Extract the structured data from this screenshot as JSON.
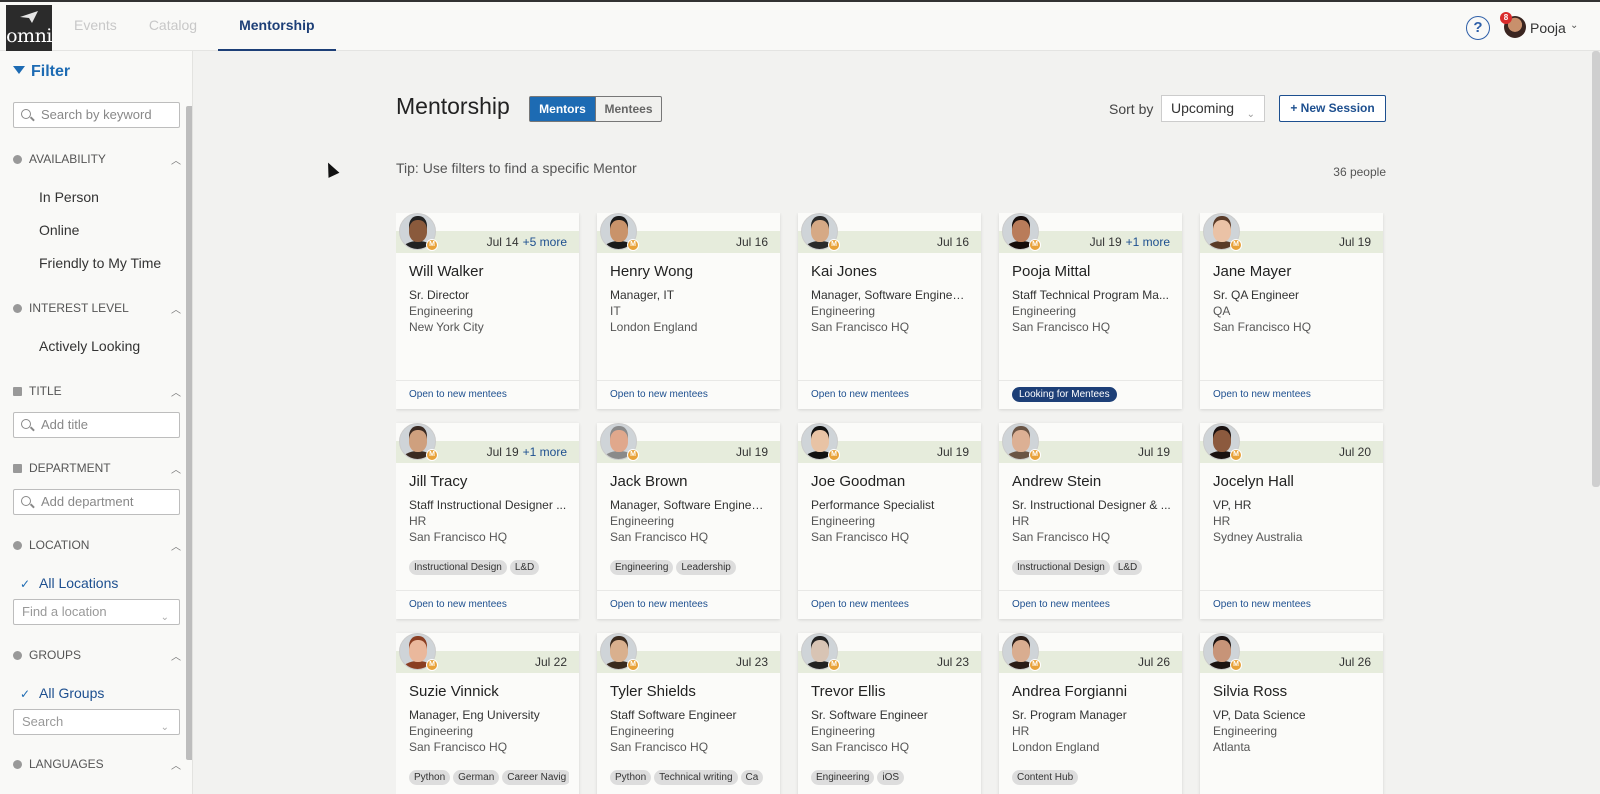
{
  "header": {
    "logo_text": "omni",
    "tabs": [
      {
        "label": "Events"
      },
      {
        "label": "Catalog"
      },
      {
        "label": "Mentorship"
      }
    ],
    "help_label": "?",
    "user": {
      "name": "Pooja",
      "notifications": "8"
    }
  },
  "sidebar": {
    "filter_label": "Filter",
    "search_placeholder": "Search by keyword",
    "availability": {
      "label": "AVAILABILITY",
      "items": [
        "In Person",
        "Online",
        "Friendly to My Time"
      ]
    },
    "interest": {
      "label": "INTEREST LEVEL",
      "items": [
        "Actively Looking"
      ]
    },
    "title": {
      "label": "TITLE",
      "placeholder": "Add title"
    },
    "department": {
      "label": "DEPARTMENT",
      "placeholder": "Add department"
    },
    "location": {
      "label": "LOCATION",
      "selected": "All Locations",
      "placeholder": "Find a location"
    },
    "groups": {
      "label": "GROUPS",
      "selected": "All Groups",
      "placeholder": "Search"
    },
    "languages": {
      "label": "LANGUAGES"
    }
  },
  "main": {
    "title": "Mentorship",
    "toggle": {
      "mentors": "Mentors",
      "mentees": "Mentees"
    },
    "sort_label": "Sort by",
    "sort_value": "Upcoming",
    "new_session": "+ New Session",
    "tip": "Tip: Use filters to find a specific Mentor",
    "count": "36 people",
    "cards": [
      {
        "name": "Will Walker",
        "date": "Jul 14",
        "more": "+5 more",
        "title": "Sr. Director",
        "dept": "Engineering",
        "loc": "New York City",
        "tags": [],
        "status": "Open to new mentees",
        "looking": false,
        "skin": "#8a5a3c",
        "hair": "#222"
      },
      {
        "name": "Henry Wong",
        "date": "Jul 16",
        "more": "",
        "title": "Manager, IT",
        "dept": "IT",
        "loc": "London England",
        "tags": [],
        "status": "Open to new mentees",
        "looking": false,
        "skin": "#c9936a",
        "hair": "#1a1a1a"
      },
      {
        "name": "Kai Jones",
        "date": "Jul 16",
        "more": "",
        "title": "Manager, Software Engineer...",
        "dept": "Engineering",
        "loc": "San Francisco HQ",
        "tags": [],
        "status": "Open to new mentees",
        "looking": false,
        "skin": "#d6a985",
        "hair": "#2a2a2a"
      },
      {
        "name": "Pooja Mittal",
        "date": "Jul 19",
        "more": "+1 more",
        "title": "Staff Technical Program Ma...",
        "dept": "Engineering",
        "loc": "San Francisco HQ",
        "tags": [],
        "status": "Looking for Mentees",
        "looking": true,
        "skin": "#b97c5a",
        "hair": "#140c0a"
      },
      {
        "name": "Jane Mayer",
        "date": "Jul 19",
        "more": "",
        "title": "Sr. QA Engineer",
        "dept": "QA",
        "loc": "San Francisco HQ",
        "tags": [],
        "status": "Open to new mentees",
        "looking": false,
        "skin": "#eac2a6",
        "hair": "#5a3b28"
      },
      {
        "name": "Jill Tracy",
        "date": "Jul 19",
        "more": "+1 more",
        "title": "Staff Instructional Designer ...",
        "dept": "HR",
        "loc": "San Francisco HQ",
        "tags": [
          "Instructional Design",
          "L&D"
        ],
        "status": "Open to new mentees",
        "looking": false,
        "skin": "#cfa07e",
        "hair": "#3a2a22"
      },
      {
        "name": "Jack Brown",
        "date": "Jul 19",
        "more": "",
        "title": "Manager, Software Engineer...",
        "dept": "Engineering",
        "loc": "San Francisco HQ",
        "tags": [
          "Engineering",
          "Leadership"
        ],
        "status": "Open to new mentees",
        "looking": false,
        "skin": "#e0a88c",
        "hair": "#8a8a8a"
      },
      {
        "name": "Joe Goodman",
        "date": "Jul 19",
        "more": "",
        "title": "Performance Specialist",
        "dept": "Engineering",
        "loc": "San Francisco HQ",
        "tags": [],
        "status": "Open to new mentees",
        "looking": false,
        "skin": "#e8c3a5",
        "hair": "#111"
      },
      {
        "name": "Andrew Stein",
        "date": "Jul 19",
        "more": "",
        "title": "Sr. Instructional Designer & ...",
        "dept": "HR",
        "loc": "San Francisco HQ",
        "tags": [
          "Instructional Design",
          "L&D"
        ],
        "status": "Open to new mentees",
        "looking": false,
        "skin": "#dcb094",
        "hair": "#6a5444"
      },
      {
        "name": "Jocelyn Hall",
        "date": "Jul 20",
        "more": "",
        "title": "VP, HR",
        "dept": "HR",
        "loc": "Sydney Australia",
        "tags": [],
        "status": "Open to new mentees",
        "looking": false,
        "skin": "#8c5a3e",
        "hair": "#1a1110"
      },
      {
        "name": "Suzie Vinnick",
        "date": "Jul 22",
        "more": "",
        "title": "Manager, Eng University",
        "dept": "Engineering",
        "loc": "San Francisco HQ",
        "tags": [
          "Python",
          "German",
          "Career Navig"
        ],
        "status": "",
        "looking": false,
        "skin": "#eab89c",
        "hair": "#8a3e22"
      },
      {
        "name": "Tyler Shields",
        "date": "Jul 23",
        "more": "",
        "title": "Staff Software Engineer",
        "dept": "Engineering",
        "loc": "San Francisco HQ",
        "tags": [
          "Python",
          "Technical writing",
          "Ca"
        ],
        "status": "",
        "looking": false,
        "skin": "#d9b08e",
        "hair": "#3a2a1e"
      },
      {
        "name": "Trevor Ellis",
        "date": "Jul 23",
        "more": "",
        "title": "Sr. Software Engineer",
        "dept": "Engineering",
        "loc": "San Francisco HQ",
        "tags": [
          "Engineering",
          "iOS"
        ],
        "status": "",
        "looking": false,
        "skin": "#d8c4b4",
        "hair": "#222"
      },
      {
        "name": "Andrea Forgianni",
        "date": "Jul 26",
        "more": "",
        "title": "Sr. Program Manager",
        "dept": "HR",
        "loc": "London England",
        "tags": [
          "Content Hub"
        ],
        "status": "",
        "looking": false,
        "skin": "#d9ad90",
        "hair": "#2a1c16"
      },
      {
        "name": "Silvia Ross",
        "date": "Jul 26",
        "more": "",
        "title": "VP, Data Science",
        "dept": "Engineering",
        "loc": "Atlanta",
        "tags": [],
        "status": "",
        "looking": false,
        "skin": "#c79478",
        "hair": "#1a1210"
      }
    ]
  }
}
